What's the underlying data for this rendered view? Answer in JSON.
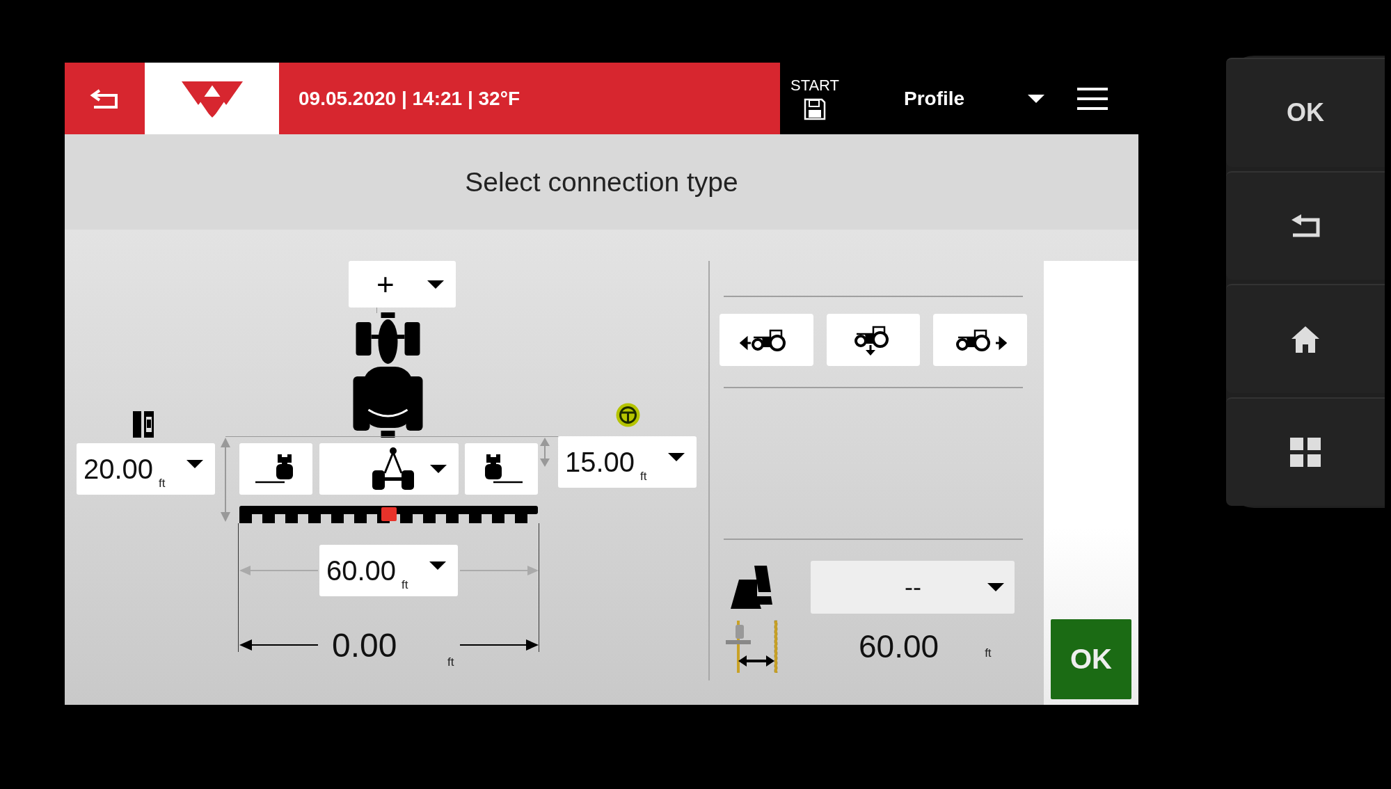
{
  "header": {
    "datetime": "09.05.2020 | 14:21 | 32°F",
    "start_label": "START",
    "profile": "Profile"
  },
  "title": "Select connection type",
  "diagram": {
    "top_dropdown": "+",
    "left_offset": {
      "value": "20.00",
      "unit": "ft"
    },
    "right_offset": {
      "value": "15.00",
      "unit": "ft"
    },
    "working_width": {
      "value": "60.00",
      "unit": "ft"
    },
    "total_width": {
      "value": "0.00",
      "unit": "ft"
    }
  },
  "right_panel": {
    "headland_dropdown": "--",
    "track_width": {
      "value": "60.00",
      "unit": "ft"
    }
  },
  "ok_button": "OK",
  "hardware_keys": [
    {
      "kind": "ok",
      "label": "OK"
    },
    {
      "kind": "back"
    },
    {
      "kind": "home"
    },
    {
      "kind": "apps"
    }
  ]
}
